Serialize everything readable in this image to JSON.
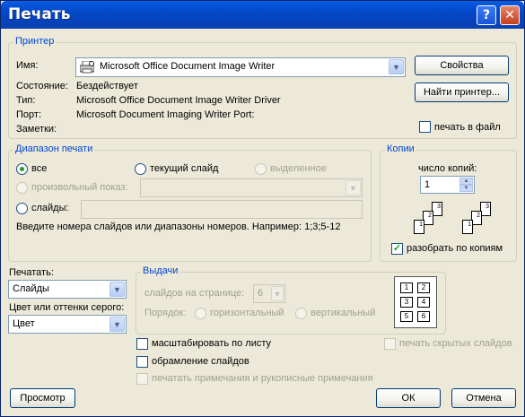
{
  "window": {
    "title": "Печать",
    "help": "?",
    "close": "✕"
  },
  "printer": {
    "legend": "Принтер",
    "name_label": "Имя:",
    "name_value": "Microsoft Office Document Image Writer",
    "status_label": "Состояние:",
    "status_value": "Бездействует",
    "type_label": "Тип:",
    "type_value": "Microsoft Office Document Image Writer Driver",
    "port_label": "Порт:",
    "port_value": "Microsoft Document Imaging Writer Port:",
    "notes_label": "Заметки:",
    "properties_button": "Свойства",
    "find_printer_button": "Найти принтер...",
    "print_to_file": "печать в файл"
  },
  "range": {
    "legend": "Диапазон печати",
    "all": "все",
    "current_slide": "текущий слайд",
    "selection": "выделенное",
    "custom_show": "произвольный показ:",
    "slides": "слайды:",
    "hint": "Введите номера слайдов или диапазоны номеров. Например: 1;3;5-12"
  },
  "copies": {
    "legend": "Копии",
    "count_label": "число копий:",
    "count_value": "1",
    "collate": "разобрать по копиям",
    "up": "▲",
    "down": "▼",
    "collate_pages": [
      "1",
      "2",
      "3",
      "1",
      "2",
      "3"
    ]
  },
  "print_what": {
    "label": "Печатать:",
    "value": "Слайды"
  },
  "color": {
    "label": "Цвет или оттенки серого:",
    "value": "Цвет"
  },
  "handouts": {
    "legend": "Выдачи",
    "per_page_label": "слайдов на странице:",
    "per_page_value": "6",
    "order_label": "Порядок:",
    "horizontal": "горизонтальный",
    "vertical": "вертикальный",
    "preview_cells": [
      "1",
      "2",
      "3",
      "4",
      "5",
      "6"
    ]
  },
  "options": {
    "scale_to_fit": "масштабировать по листу",
    "frame_slides": "обрамление слайдов",
    "print_comments": "печатать примечания и рукописные примечания",
    "print_hidden": "печать скрытых слайдов"
  },
  "footer": {
    "preview": "Просмотр",
    "ok": "ОК",
    "cancel": "Отмена"
  },
  "icons": {
    "combo_arrow": "▼",
    "check": "✓"
  }
}
